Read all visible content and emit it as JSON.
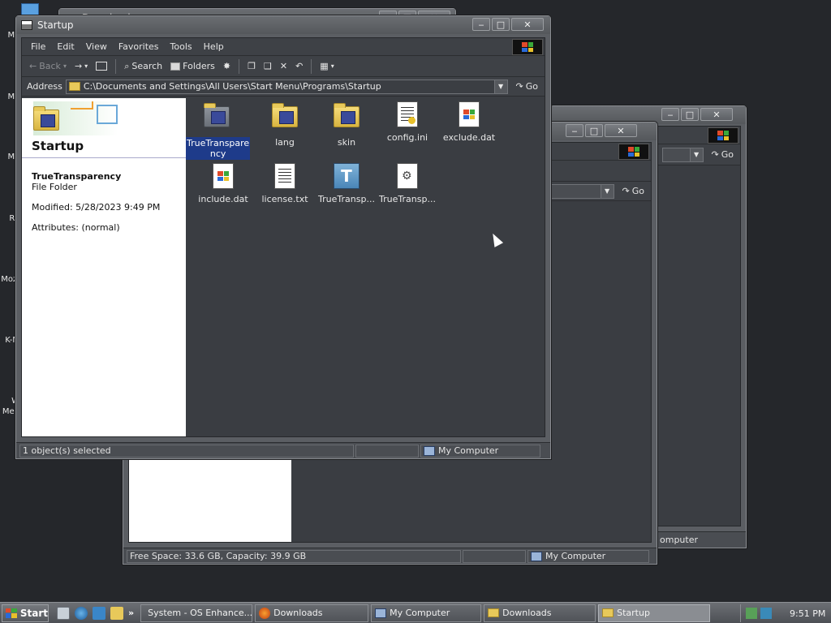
{
  "desktop": {
    "icons": [
      {
        "label": "My",
        "icon": "my-documents-icon"
      },
      {
        "label": "My",
        "icon": "my-computer-icon"
      },
      {
        "label": "My",
        "icon": "my-network-icon"
      },
      {
        "label": "Re",
        "icon": "recycle-bin-icon"
      },
      {
        "label": "Mozi",
        "icon": "mozilla-icon"
      },
      {
        "label": "K-M",
        "icon": "kmplayer-icon"
      },
      {
        "label": "W",
        "icon": "media-player-icon"
      },
      {
        "label": "Med",
        "icon": "media-player-icon"
      }
    ]
  },
  "back_window_1": {
    "title": "Downloads",
    "go_label": "Go",
    "status": "omputer"
  },
  "back_window_2": {
    "go_label": "Go",
    "status_left": "Free Space: 33.6 GB, Capacity: 39.9 GB",
    "status_right": "My Computer"
  },
  "window": {
    "title": "Startup",
    "menu": [
      "File",
      "Edit",
      "View",
      "Favorites",
      "Tools",
      "Help"
    ],
    "toolbar": {
      "back": "Back",
      "search": "Search",
      "folders": "Folders"
    },
    "address_label": "Address",
    "address_value": "C:\\Documents and Settings\\All Users\\Start Menu\\Programs\\Startup",
    "go_label": "Go",
    "sidepanel": {
      "title": "Startup",
      "item_name": "TrueTransparency",
      "item_type": "File Folder",
      "modified": "Modified: 5/28/2023 9:49 PM",
      "attributes": "Attributes: (normal)"
    },
    "files": [
      {
        "name": "TrueTransparency",
        "label": "TrueTranspare ncy",
        "kind": "folder-app",
        "selected": true
      },
      {
        "name": "lang",
        "label": "lang",
        "kind": "folder-app"
      },
      {
        "name": "skin",
        "label": "skin",
        "kind": "folder-app"
      },
      {
        "name": "config.ini",
        "label": "config.ini",
        "kind": "ini"
      },
      {
        "name": "exclude.dat",
        "label": "exclude.dat",
        "kind": "dat"
      },
      {
        "name": "include.dat",
        "label": "include.dat",
        "kind": "dat"
      },
      {
        "name": "license.txt",
        "label": "license.txt",
        "kind": "txt"
      },
      {
        "name": "TrueTransparency.exe",
        "label": "TrueTransp...",
        "kind": "exe"
      },
      {
        "name": "TrueTransparency.cfg",
        "label": "TrueTransp...",
        "kind": "gear"
      }
    ],
    "status_left": "1 object(s) selected",
    "status_right": "My Computer"
  },
  "taskbar": {
    "start_label": "Start",
    "tasks": [
      {
        "label": "System - OS Enhance...",
        "icon": "firefox-icon",
        "active": false
      },
      {
        "label": "Downloads",
        "icon": "firefox-icon",
        "active": false
      },
      {
        "label": "My Computer",
        "icon": "computer-icon",
        "active": false
      },
      {
        "label": "Downloads",
        "icon": "folder-icon",
        "active": false
      },
      {
        "label": "Startup",
        "icon": "folder-icon",
        "active": true
      }
    ],
    "clock": "9:51 PM",
    "more": "»"
  }
}
